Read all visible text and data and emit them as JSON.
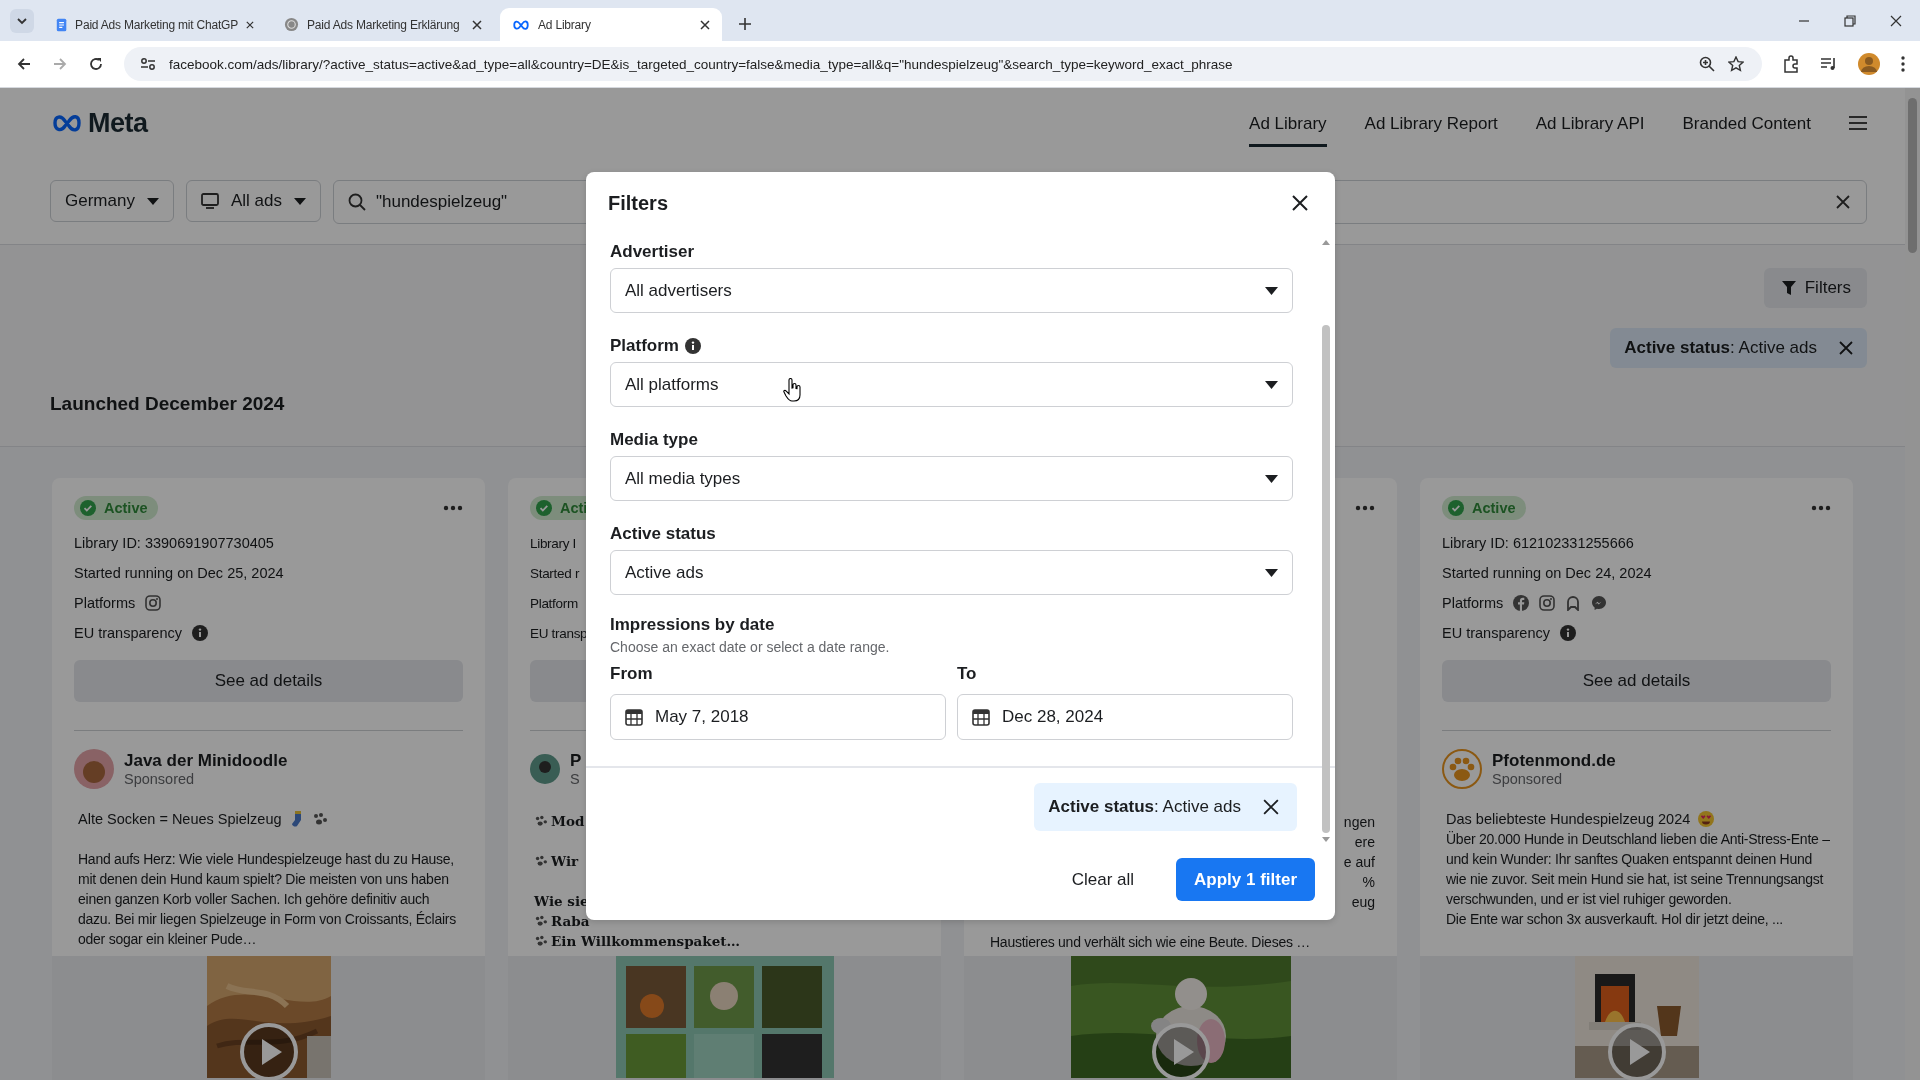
{
  "browser": {
    "tabs": [
      {
        "title": "Paid Ads Marketing mit ChatGP",
        "selected": false
      },
      {
        "title": "Paid Ads Marketing Erklärung",
        "selected": false
      },
      {
        "title": "Ad Library",
        "selected": true
      }
    ],
    "url": "facebook.com/ads/library/?active_status=active&ad_type=all&country=DE&is_targeted_country=false&media_type=all&q=\"hundespielzeug\"&search_type=keyword_exact_phrase"
  },
  "header": {
    "logo": "Meta",
    "nav": [
      {
        "label": "Ad Library",
        "selected": true
      },
      {
        "label": "Ad Library Report",
        "selected": false
      },
      {
        "label": "Ad Library API",
        "selected": false
      },
      {
        "label": "Branded Content",
        "selected": false
      }
    ]
  },
  "search_bar": {
    "country": "Germany",
    "ad_type": "All ads",
    "query": "\"hundespielzeug\""
  },
  "filters_button": "Filters",
  "active_filter_chip": "**Active status**: Active ads",
  "section_title": "Launched December 2024",
  "cards": [
    {
      "kind": "full",
      "status": "Active",
      "active": true,
      "library_id": "Library ID: 3390691907730405",
      "started": "Started running on Dec 25, 2024",
      "platforms_label": "Platforms",
      "eu_label": "EU transparency",
      "details_button": "See ad details",
      "advertiser": "Java der Minidoodle",
      "sponsored": "Sponsored",
      "headline": "Alte Socken = Neues Spielzeug",
      "body": [
        "Hand aufs Herz: Wie viele Hundespielzeuge hast du zu Hause, mit denen dein Hund kaum spielt? Die meisten von uns haben einen ganzen Korb voller Sachen. Ich gehöre definitiv auch dazu. Bei mir liegen Spielzeuge in Form von Croissants, Éclairs oder sogar ein kleiner Pude…"
      ]
    },
    {
      "kind": "left_stub",
      "status": "Acti",
      "active": true,
      "lines": [
        "Library I",
        "Started r",
        "Platform",
        "EU transp"
      ],
      "advertiser": "P",
      "sponsored": "S",
      "text": [
        {
          "kind": "paw",
          "text": "Mod"
        },
        {
          "kind": "gap"
        },
        {
          "kind": "paw",
          "text": "Wir"
        },
        {
          "kind": "gap"
        },
        {
          "kind": "plain",
          "text": "Wie sie"
        },
        {
          "kind": "paw",
          "text": "Raba"
        },
        {
          "kind": "paw",
          "text": "Ein Willkommenspaket…"
        }
      ]
    },
    {
      "kind": "right_stub",
      "fragments": [
        "ngen",
        "ere",
        "e auf",
        "%",
        "eug"
      ],
      "last_line": "Haustieres und verhält sich wie eine Beute. Dieses …"
    },
    {
      "kind": "full",
      "status": "Active",
      "active": true,
      "library_id": "Library ID: 612102331255666",
      "started": "Started running on Dec 24, 2024",
      "platforms_label": "Platforms",
      "eu_label": "EU transparency",
      "details_button": "See ad details",
      "advertiser": "Pfotenmond.de",
      "sponsored": "Sponsored",
      "headline": "Das beliebteste Hundespielzeug 2024",
      "body": [
        "Über 20.000 Hunde in Deutschland lieben die Anti-Stress-Ente – und kein Wunder: Ihr sanftes Quaken entspannt deinen Hund wie nie zuvor. Seit mein Hund sie hat, ist seine Trennungsangst verschwunden, und er ist viel ruhiger geworden.",
        "Die Ente war schon 3x ausverkauft. Hol dir jetzt deine, ..."
      ]
    }
  ],
  "modal": {
    "title": "Filters",
    "fields": [
      {
        "label": "Advertiser",
        "value": "All advertisers",
        "info": false
      },
      {
        "label": "Platform",
        "value": "All platforms",
        "info": true
      },
      {
        "label": "Media type",
        "value": "All media types",
        "info": false
      },
      {
        "label": "Active status",
        "value": "Active ads",
        "info": false
      }
    ],
    "date_title": "Impressions by date",
    "date_hint": "Choose an exact date or select a date range.",
    "from_label": "From",
    "from": "May 7, 2018",
    "to_label": "To",
    "to": "Dec 28, 2024",
    "chip": "**Active status**: Active ads",
    "clear_button": "Clear all",
    "apply_button": "Apply 1 filter"
  }
}
